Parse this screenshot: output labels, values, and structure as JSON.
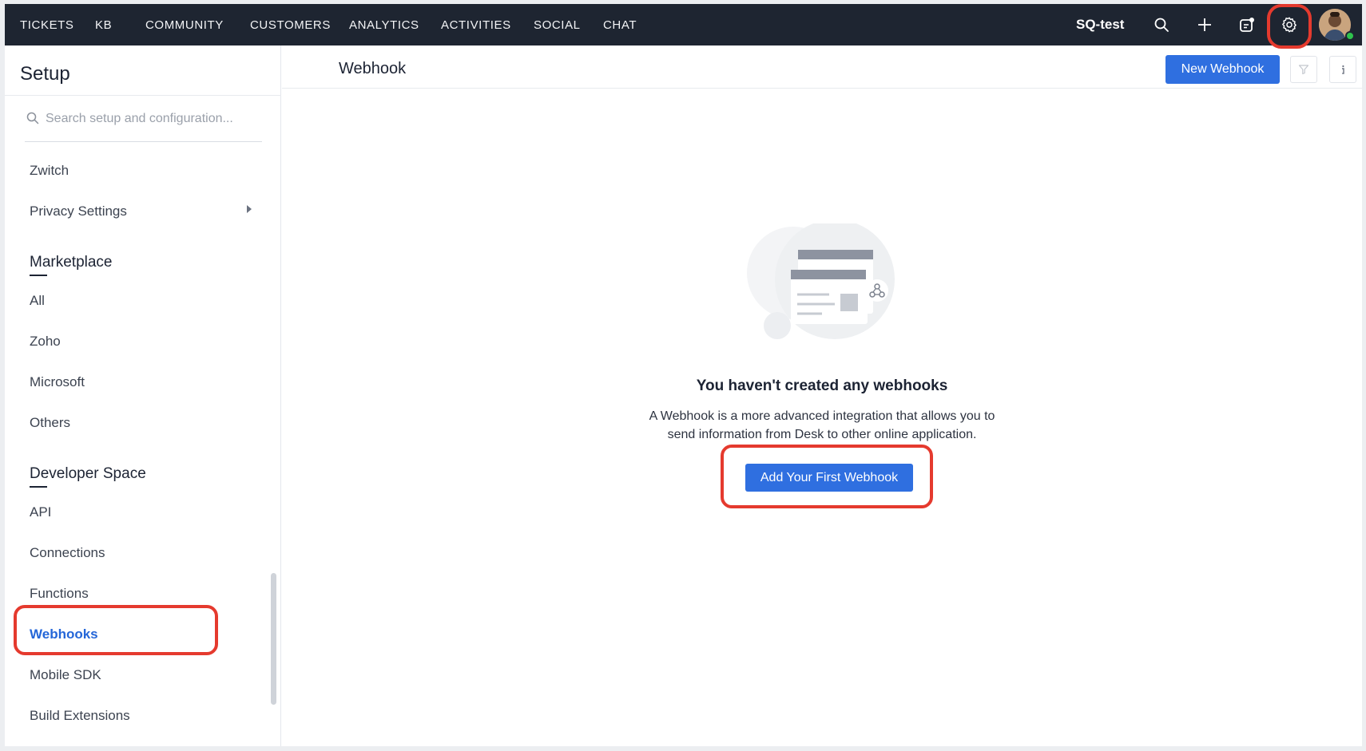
{
  "topnav": {
    "tabs": [
      {
        "label": "TICKETS"
      },
      {
        "label": "KB"
      },
      {
        "label": "COMMUNITY"
      },
      {
        "label": "CUSTOMERS"
      },
      {
        "label": "ANALYTICS"
      },
      {
        "label": "ACTIVITIES"
      },
      {
        "label": "SOCIAL"
      },
      {
        "label": "CHAT"
      }
    ],
    "org_name": "SQ-test",
    "icons": [
      "search-icon",
      "plus-icon",
      "notification-icon",
      "gear-icon",
      "avatar"
    ]
  },
  "sidebar": {
    "title": "Setup",
    "search_placeholder": "Search setup and configuration...",
    "items_top": [
      {
        "label": "Zwitch"
      },
      {
        "label": "Privacy Settings"
      }
    ],
    "marketplace": {
      "header": "Marketplace",
      "items": [
        {
          "label": "All"
        },
        {
          "label": "Zoho"
        },
        {
          "label": "Microsoft"
        },
        {
          "label": "Others"
        }
      ]
    },
    "developer": {
      "header": "Developer Space",
      "items": [
        {
          "label": "API"
        },
        {
          "label": "Connections"
        },
        {
          "label": "Functions"
        },
        {
          "label": "Webhooks"
        },
        {
          "label": "Mobile SDK"
        },
        {
          "label": "Build Extensions"
        }
      ]
    },
    "active_item": "Webhooks"
  },
  "main": {
    "title": "Webhook",
    "new_button": "New Webhook",
    "empty_state": {
      "title": "You haven't created any webhooks",
      "desc_line1": "A Webhook is a more advanced integration that allows you to",
      "desc_line2": "send information from Desk to other online application.",
      "cta": "Add Your First Webhook"
    }
  },
  "colors": {
    "nav_bg": "#1e2531",
    "primary": "#2f6fe0",
    "highlight": "#e53a2e",
    "active_link": "#2466d8"
  }
}
